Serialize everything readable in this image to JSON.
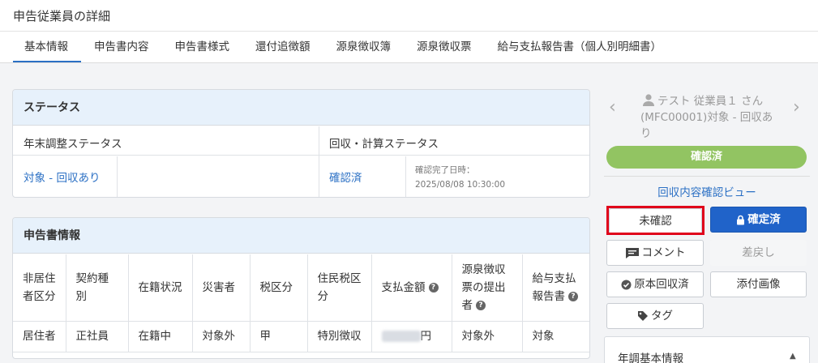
{
  "page_title": "申告従業員の詳細",
  "tabs": [
    {
      "label": "基本情報",
      "active": true
    },
    {
      "label": "申告書内容"
    },
    {
      "label": "申告書様式"
    },
    {
      "label": "還付追徴額"
    },
    {
      "label": "源泉徴収簿"
    },
    {
      "label": "源泉徴収票"
    },
    {
      "label": "給与支払報告書（個人別明細書）"
    }
  ],
  "status": {
    "title": "ステータス",
    "col1_header": "年末調整ステータス",
    "col2_header": "回収・計算ステータス",
    "col1_value": "対象 - 回収あり",
    "col2_value": "確認済",
    "confirm_label": "確認完了日時：",
    "confirm_datetime": "2025/08/08 10:30:00"
  },
  "declaration": {
    "title": "申告書情報",
    "headers": [
      "非居住者区分",
      "契約種別",
      "在籍状況",
      "災害者",
      "税区分",
      "住民税区分",
      "支払金額",
      "源泉徴収票の提出者",
      "給与支払報告書"
    ],
    "values": [
      "居住者",
      "正社員",
      "在籍中",
      "対象外",
      "甲",
      "特別徴収",
      "円",
      "対象外",
      "対象"
    ]
  },
  "employee": {
    "name": "テスト 従業員１ さん",
    "sub": "(MFC00001)対象 - 回収あり",
    "prev": "‹",
    "next": "›"
  },
  "status_pill": "確認済",
  "view_link": "回収内容確認ビュー",
  "buttons": {
    "unconfirmed": "未確認",
    "confirmed": "確定済",
    "comment": "コメント",
    "sendback": "差戻し",
    "original": "原本回収済",
    "attachment": "添付画像",
    "tag": "タグ"
  },
  "panel2_title": "年調基本情報",
  "colors": {
    "accent": "#2a6fc4",
    "primary_button": "#2063c9",
    "status_green": "#92c462",
    "highlight_red": "#e0001b"
  }
}
